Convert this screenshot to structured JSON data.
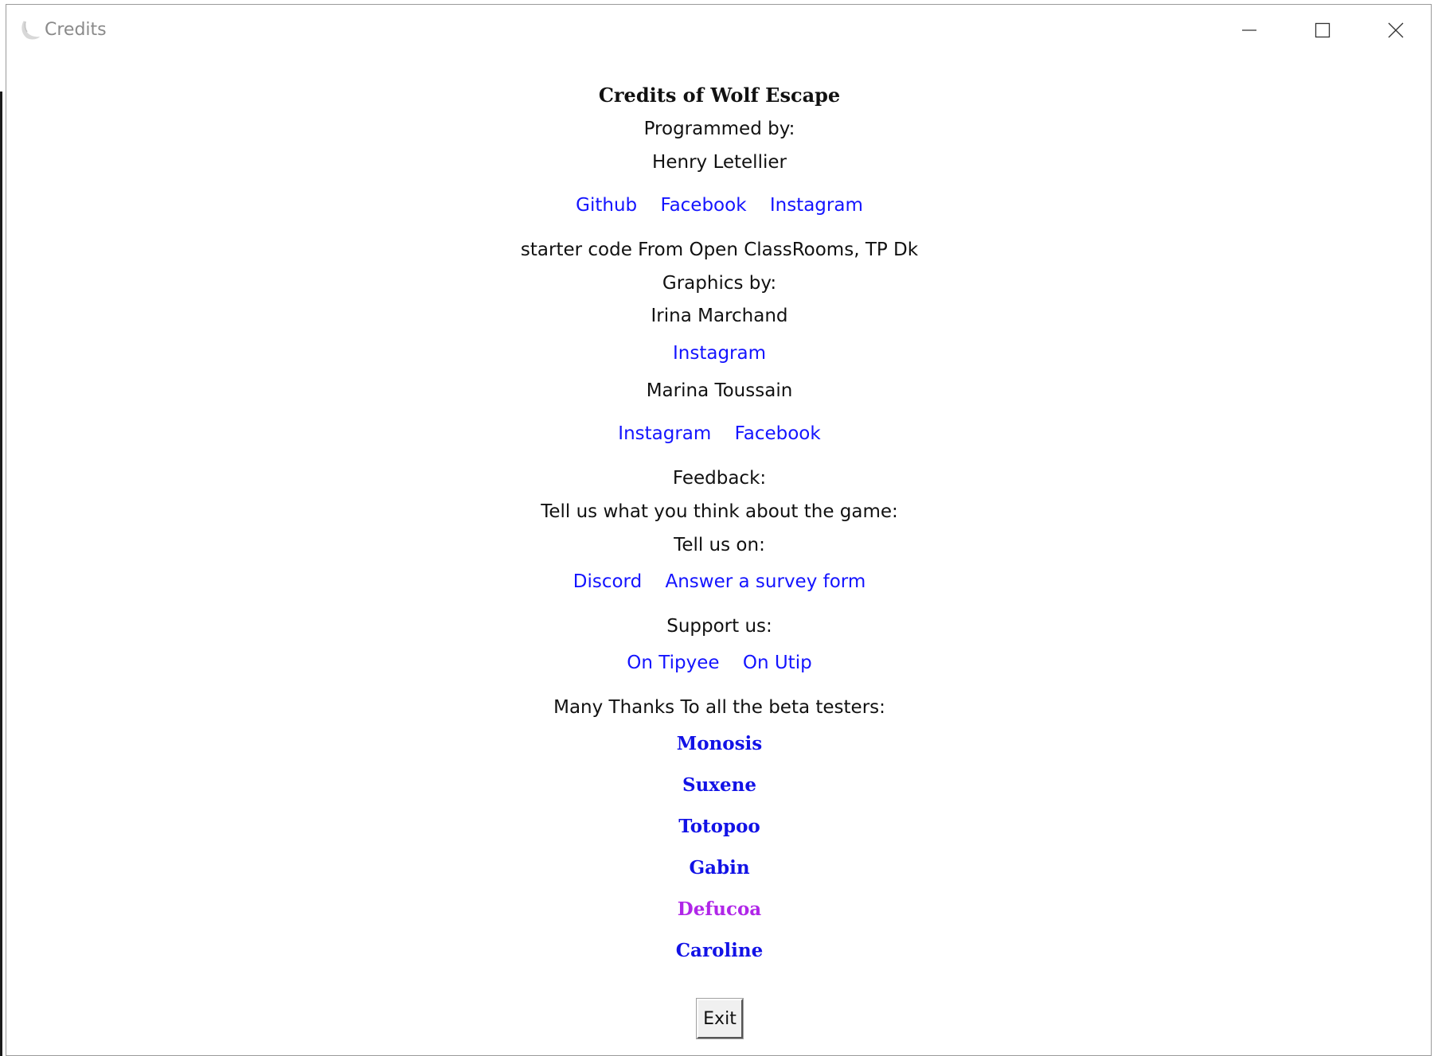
{
  "window": {
    "title": "Credits",
    "controls": {
      "minimize": "minimize-icon",
      "maximize": "maximize-icon",
      "close": "close-icon"
    }
  },
  "credits": {
    "heading": "Credits of Wolf Escape",
    "programmed_by_label": "Programmed by:",
    "programmer_name": "Henry Letellier",
    "programmer_links": [
      "Github",
      "Facebook",
      "Instagram"
    ],
    "starter_code": "starter code From Open ClassRooms, TP Dk",
    "graphics_by_label": "Graphics by:",
    "artist1_name": "Irina Marchand",
    "artist1_links": [
      "Instagram"
    ],
    "artist2_name": "Marina Toussain",
    "artist2_links": [
      "Instagram",
      "Facebook"
    ],
    "feedback_label": "Feedback:",
    "feedback_prompt": "Tell us what you think about the game:",
    "tell_us_on_label": "Tell us on:",
    "feedback_links": [
      "Discord",
      "Answer a survey form"
    ],
    "support_label": "Support us:",
    "support_links": [
      "On Tipyee",
      "On Utip"
    ],
    "thanks_label": "Many Thanks To all the beta testers:",
    "beta_testers": [
      "Monosis",
      "Suxene",
      "Totopoo",
      "Gabin",
      "Defucoa",
      "Caroline"
    ]
  },
  "colors": {
    "link": "#1414ff",
    "tester": "#1212e6",
    "tester_highlight": "#b026e8"
  },
  "exit_button": {
    "label": "Exit"
  }
}
